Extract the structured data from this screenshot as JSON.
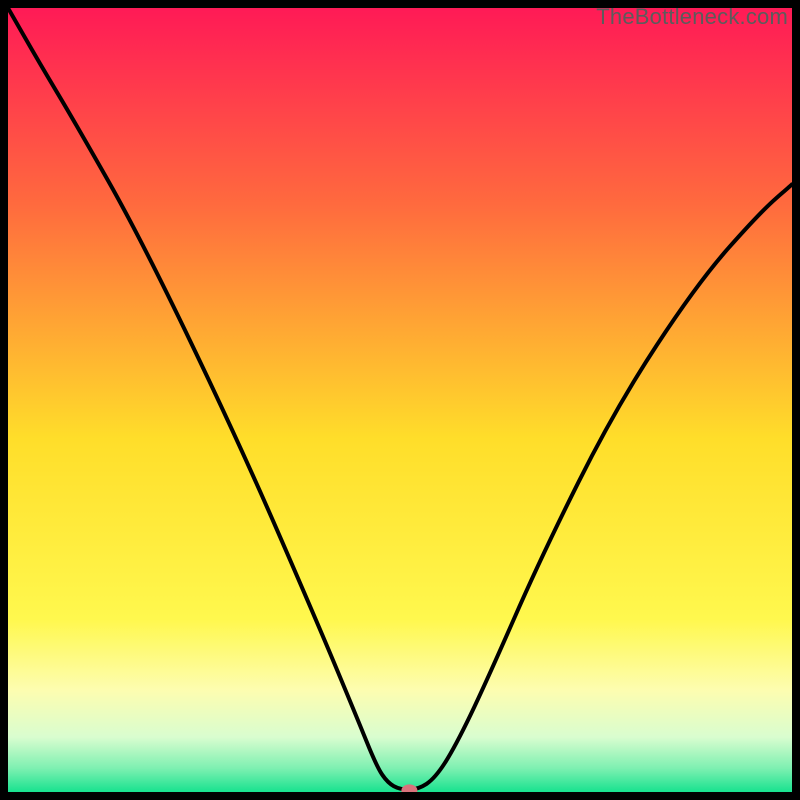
{
  "watermark": "TheBottleneck.com",
  "chart_data": {
    "type": "line",
    "title": "",
    "xlabel": "",
    "ylabel": "",
    "xlim": [
      0,
      1
    ],
    "ylim": [
      0,
      1
    ],
    "series": [
      {
        "name": "bottleneck-curve",
        "x": [
          0.0,
          0.04,
          0.085,
          0.17,
          0.295,
          0.395,
          0.445,
          0.47,
          0.484,
          0.5,
          0.523,
          0.545,
          0.57,
          0.61,
          0.68,
          0.775,
          0.88,
          0.96,
          1.0
        ],
        "y": [
          1.0,
          0.93,
          0.855,
          0.705,
          0.445,
          0.215,
          0.095,
          0.033,
          0.012,
          0.003,
          0.003,
          0.018,
          0.057,
          0.14,
          0.3,
          0.49,
          0.65,
          0.74,
          0.775
        ]
      }
    ],
    "marker": {
      "x": 0.512,
      "y": 0.002,
      "color": "#d9737c",
      "name": "current-spec"
    },
    "background_gradient": {
      "stops": [
        {
          "offset": 0.0,
          "color": "#ff1a56"
        },
        {
          "offset": 0.25,
          "color": "#ff6a3e"
        },
        {
          "offset": 0.55,
          "color": "#ffde2a"
        },
        {
          "offset": 0.78,
          "color": "#fff84e"
        },
        {
          "offset": 0.87,
          "color": "#fdfdb0"
        },
        {
          "offset": 0.93,
          "color": "#d9fdcf"
        },
        {
          "offset": 0.97,
          "color": "#7df0b1"
        },
        {
          "offset": 1.0,
          "color": "#18e28f"
        }
      ]
    }
  }
}
